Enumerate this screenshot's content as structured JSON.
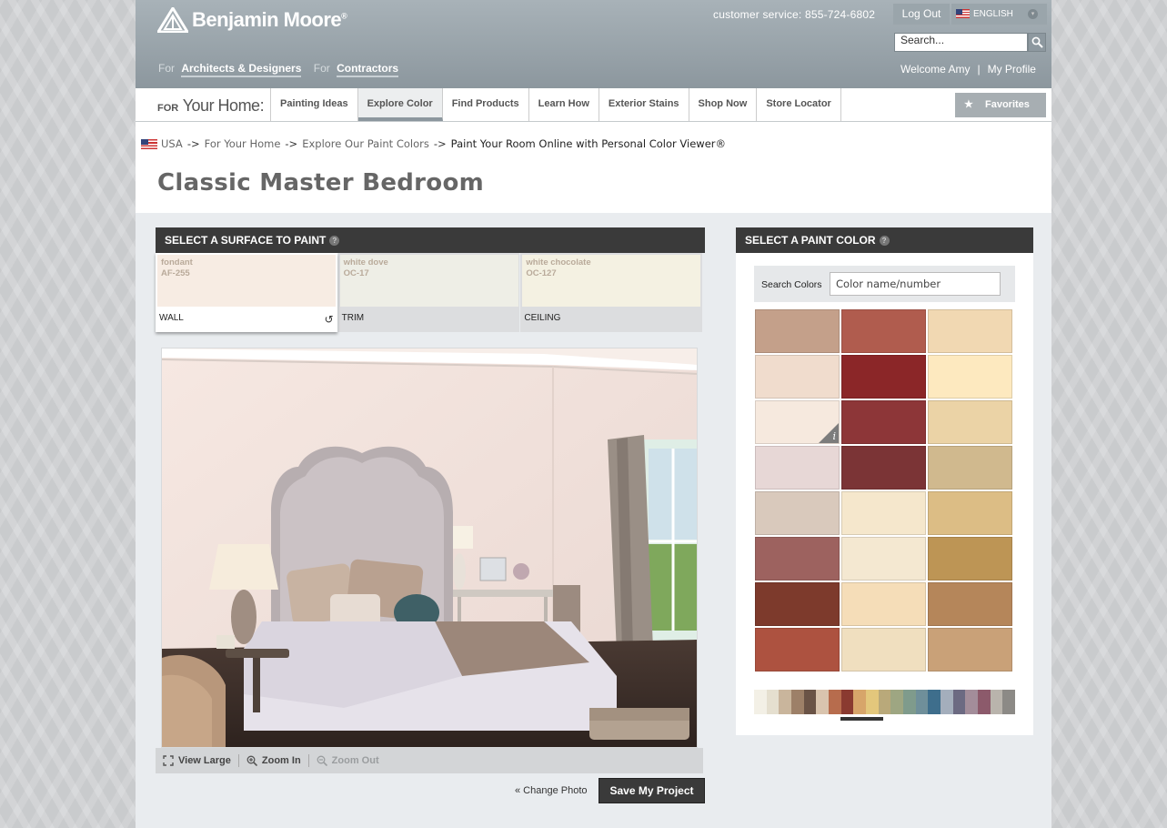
{
  "header": {
    "brand": "Benjamin Moore",
    "brand_mark": "®",
    "for_label_1": "For",
    "link_architects": "Architects & Designers",
    "for_label_2": "For",
    "link_contractors": "Contractors",
    "customer_service": "customer service: 855-724-6802",
    "logout": "Log Out",
    "language": "ENGLISH",
    "search_placeholder": "Search...",
    "welcome": "Welcome Amy",
    "separator": "|",
    "my_profile": "My Profile"
  },
  "nav": {
    "for_small": "FOR",
    "your_home": "Your Home:",
    "tabs": [
      "Painting Ideas",
      "Explore Color",
      "Find Products",
      "Learn How",
      "Exterior Stains",
      "Shop Now",
      "Store Locator"
    ],
    "active_tab": "Explore Color",
    "favorites": "Favorites"
  },
  "breadcrumb": {
    "items": [
      "USA",
      "For Your Home",
      "Explore Our Paint Colors",
      "Paint Your Room Online with Personal Color Viewer®"
    ],
    "arrow": "->"
  },
  "page_title": "Classic Master Bedroom",
  "surface_panel": {
    "title": "SELECT A SURFACE TO PAINT",
    "help": "?",
    "surfaces": [
      {
        "name": "fondant",
        "code": "AF-255",
        "label": "WALL",
        "color": "#f7ece3"
      },
      {
        "name": "white dove",
        "code": "OC-17",
        "label": "TRIM",
        "color": "#eeeee6"
      },
      {
        "name": "white chocolate",
        "code": "OC-127",
        "label": "CEILING",
        "color": "#f4f1e2"
      }
    ],
    "undo": "↺"
  },
  "photo_toolbar": {
    "view_large": "View Large",
    "zoom_in": "Zoom In",
    "zoom_out": "Zoom Out"
  },
  "change_photo": "« Change Photo",
  "save_project": "Save My Project",
  "color_panel": {
    "title": "SELECT A PAINT COLOR",
    "help": "?",
    "search_label": "Search Colors",
    "search_placeholder": "Color name/number",
    "info_glyph": "i",
    "chips": [
      "#c4a08a",
      "#b05c4e",
      "#f1d8b2",
      "#f0dccd",
      "#8b2628",
      "#fde9bf",
      "#f6e9de",
      "#8d3638",
      "#ebd3a6",
      "#e7d7d6",
      "#7b3436",
      "#d0b98e",
      "#d9c9bc",
      "#f5e7cc",
      "#dcbd85",
      "#9d625f",
      "#f4e8d1",
      "#bd9555",
      "#7d3a2c",
      "#f5ddb8",
      "#b5865a",
      "#ad5240",
      "#f0dfbf",
      "#c9a178"
    ],
    "selected_chip": 6,
    "spectrum": [
      "#f3f0e6",
      "#e5dfcf",
      "#c9b59c",
      "#9d8068",
      "#6a5346",
      "#d9c4ae",
      "#b76c4d",
      "#8a3a30",
      "#d7a56a",
      "#e3c77c",
      "#b9a97a",
      "#9ea682",
      "#7f9b8c",
      "#6f8f9a",
      "#3e6e8c",
      "#a4aebc",
      "#6c6a82",
      "#a38d9a",
      "#8c5a6b",
      "#b9b4ac",
      "#8c8a86"
    ]
  },
  "colors": {
    "header_top": "#a8b2b8",
    "header_bottom": "#8c979e",
    "panel_header": "#3a3a3a"
  }
}
